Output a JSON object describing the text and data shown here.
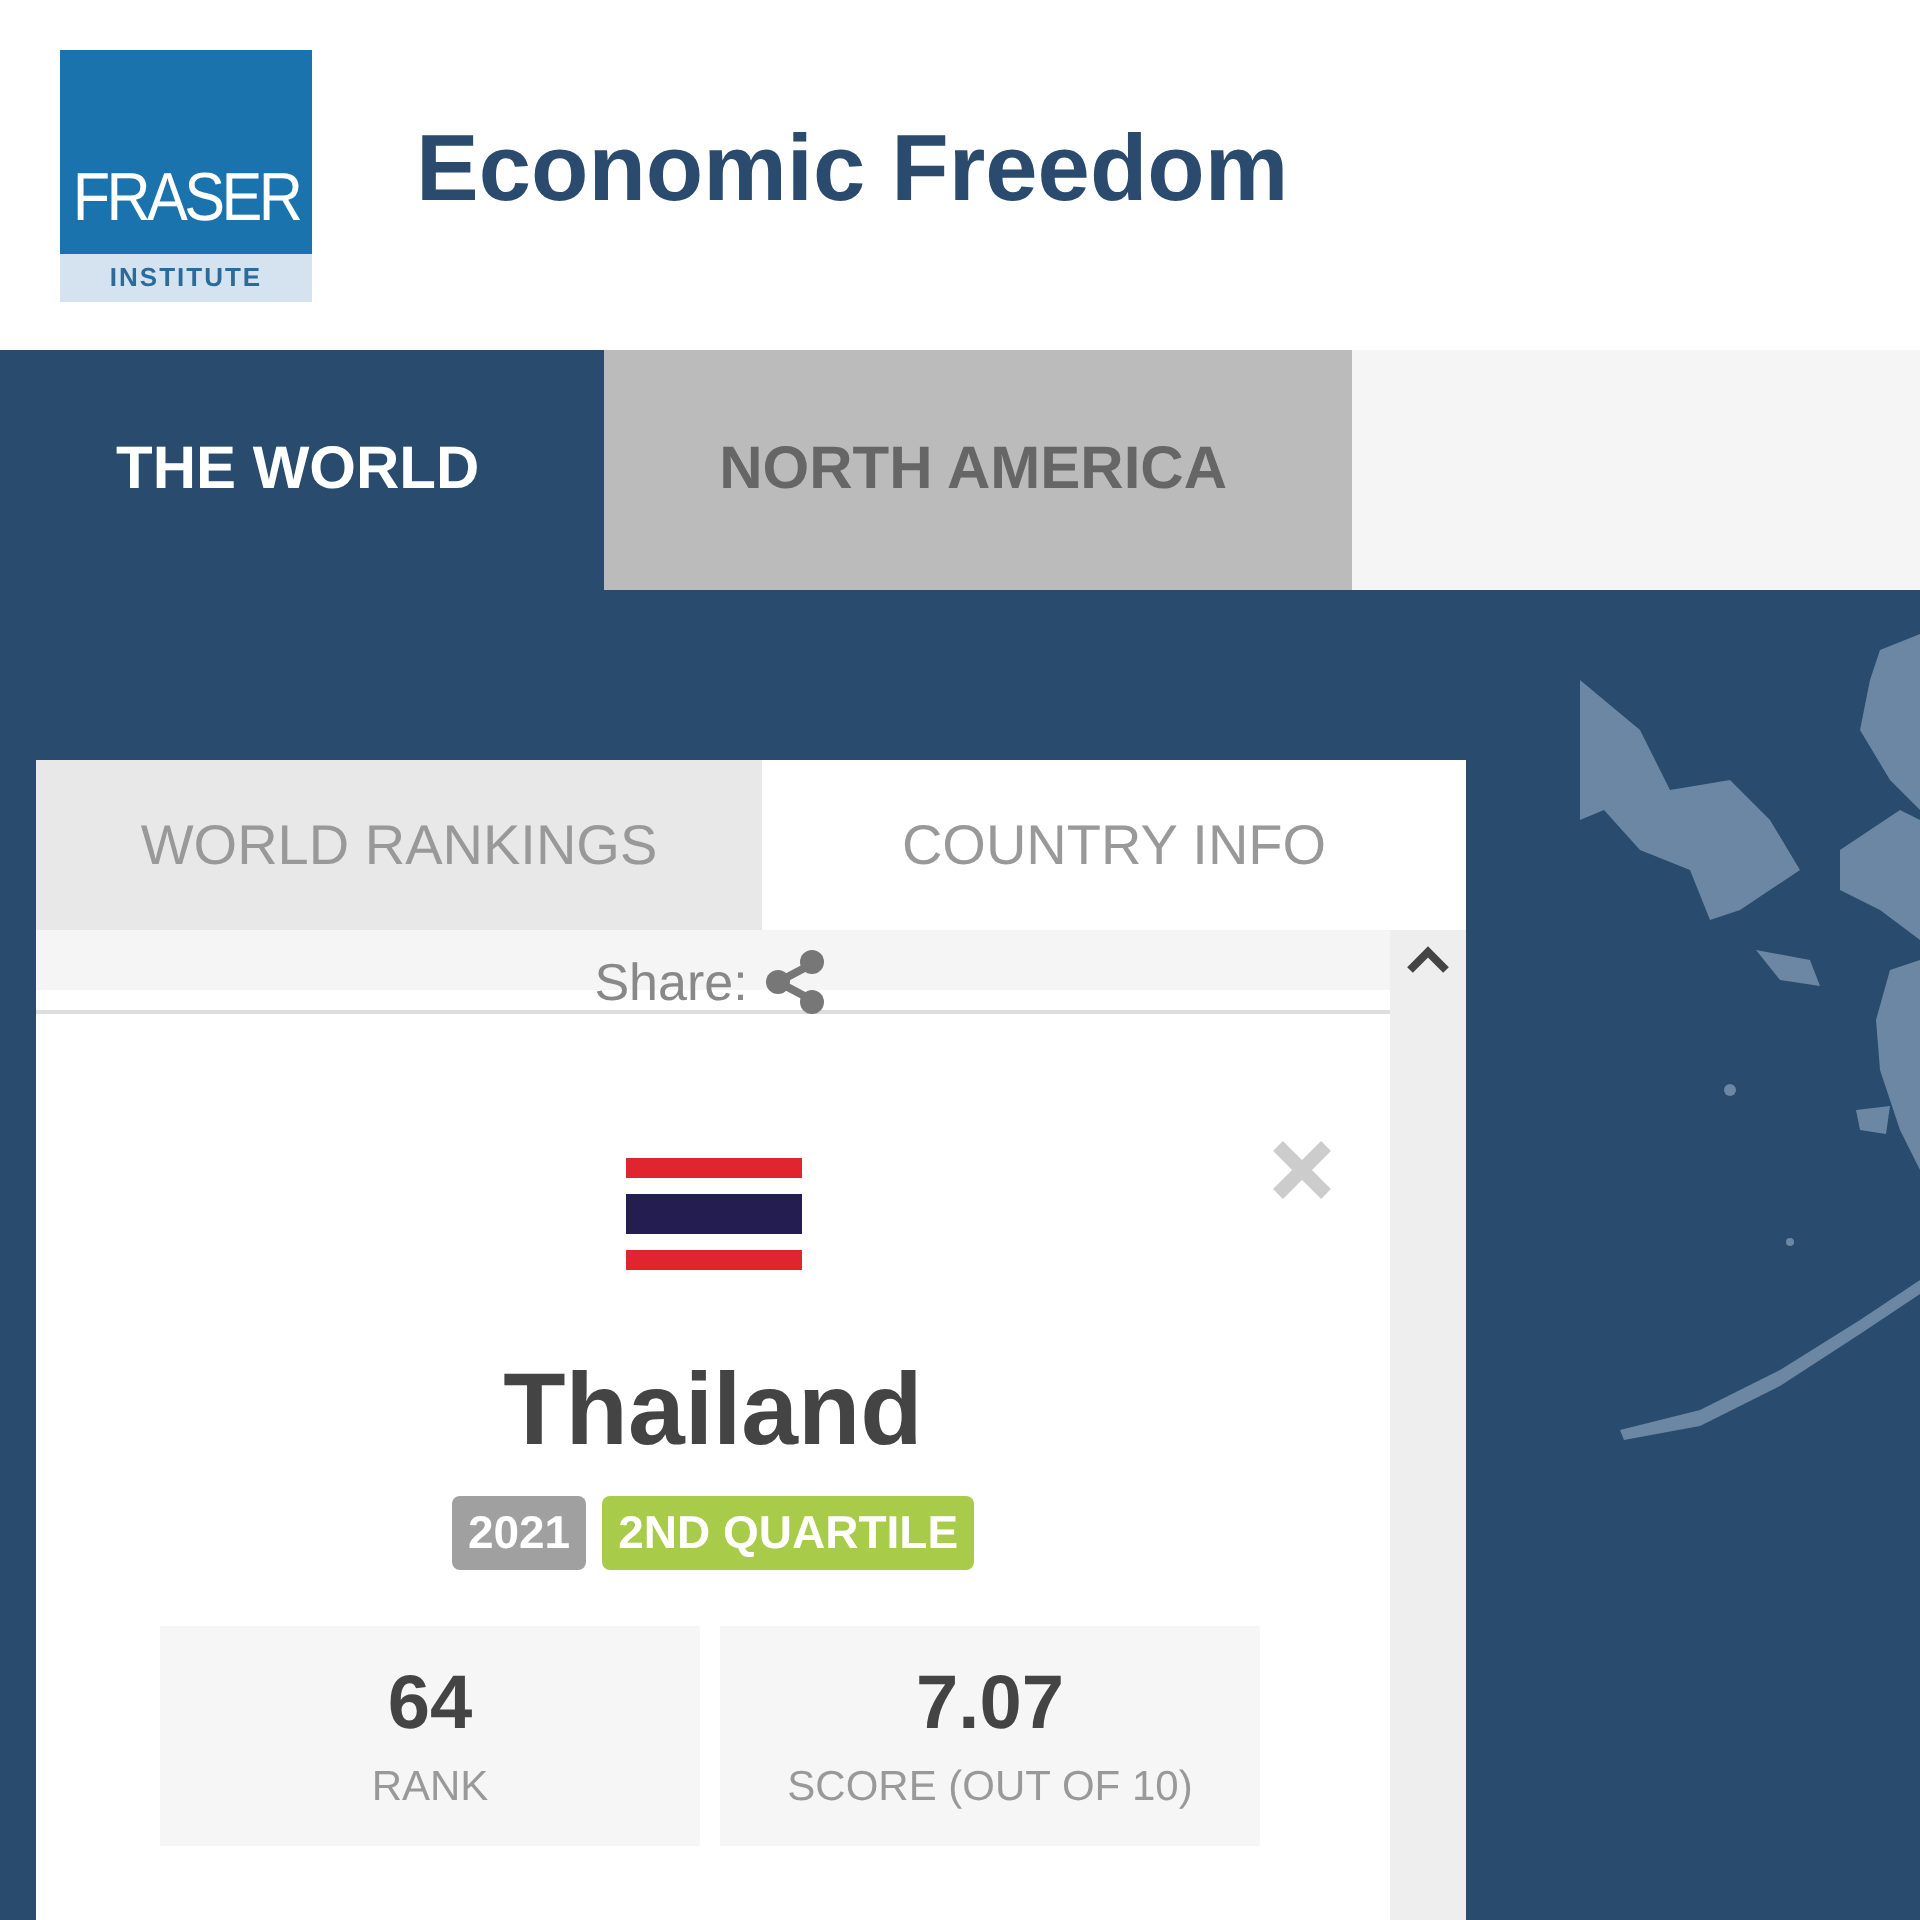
{
  "logo": {
    "name": "FRASER",
    "subtitle": "INSTITUTE"
  },
  "title": "Economic Freedom",
  "nav_tabs": [
    {
      "label": "THE WORLD",
      "selected": true
    },
    {
      "label": "NORTH AMERICA",
      "selected": false
    }
  ],
  "panel": {
    "tabs": [
      {
        "label": "WORLD RANKINGS",
        "selected": false
      },
      {
        "label": "COUNTRY INFO",
        "selected": true
      }
    ],
    "share_label": "Share:",
    "country": "Thailand",
    "badges": [
      {
        "text": "2021",
        "color": "#a0a0a0"
      },
      {
        "text": "2ND QUARTILE",
        "color": "#a8cc4a"
      }
    ],
    "stats": [
      {
        "value": "64",
        "label": "RANK"
      },
      {
        "value": "7.07",
        "label": "SCORE (OUT OF 10)"
      }
    ]
  }
}
